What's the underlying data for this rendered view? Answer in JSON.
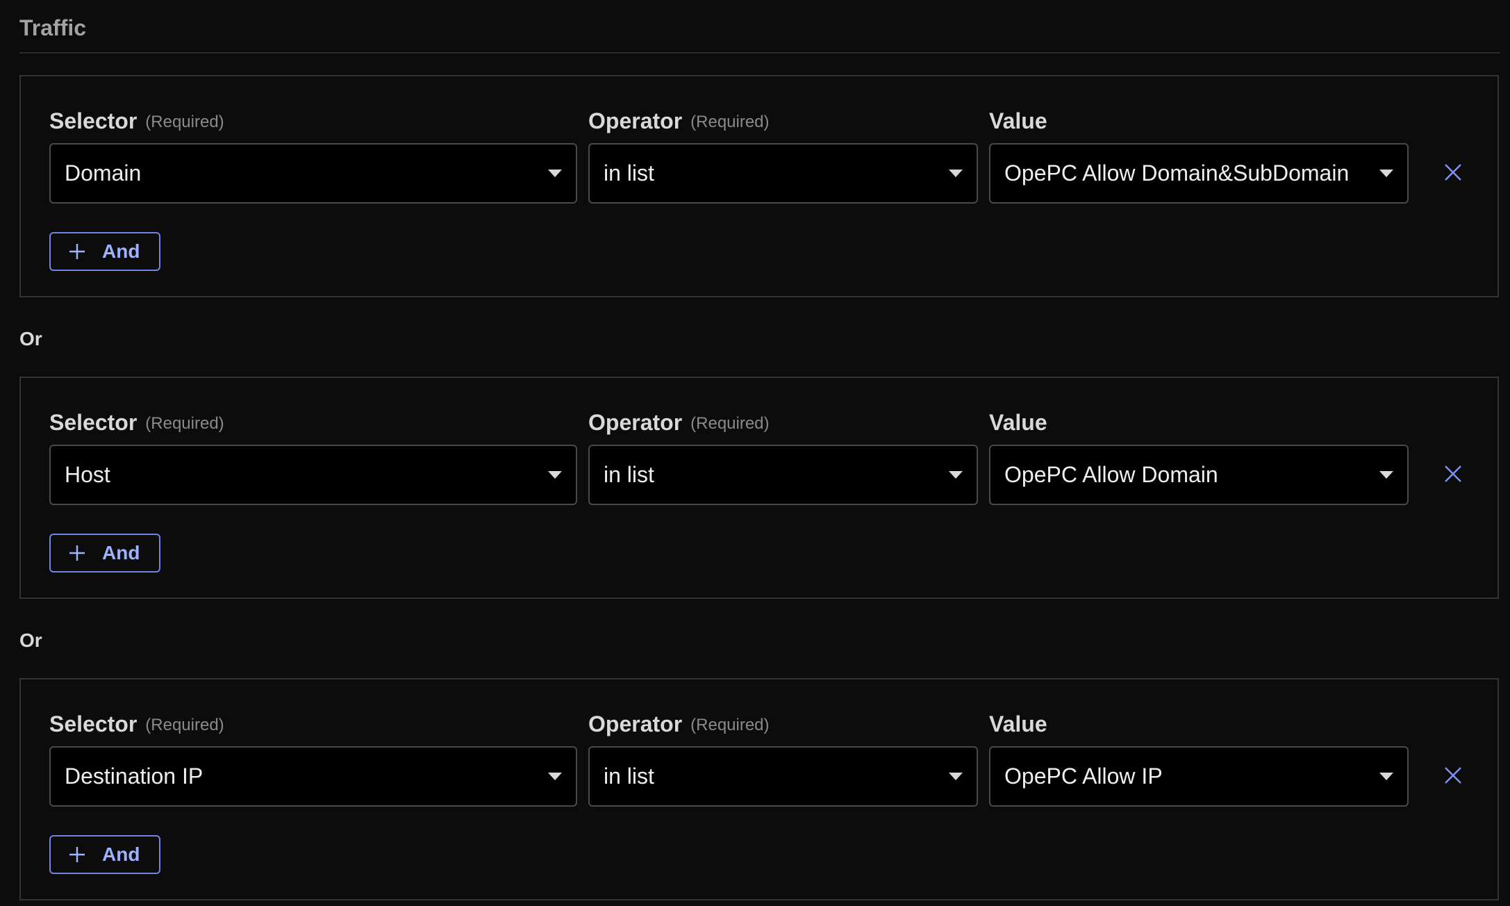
{
  "section": {
    "title": "Traffic"
  },
  "labels": {
    "selector": "Selector",
    "operator": "Operator",
    "value": "Value",
    "required": "(Required)",
    "and_button": "And",
    "or": "Or"
  },
  "rules": [
    {
      "selector": "Domain",
      "operator": "in list",
      "value": "OpePC Allow Domain&SubDomain"
    },
    {
      "selector": "Host",
      "operator": "in list",
      "value": "OpePC Allow Domain"
    },
    {
      "selector": "Destination IP",
      "operator": "in list",
      "value": "OpePC Allow IP"
    }
  ],
  "icons": {
    "remove": "close-icon",
    "add": "plus-icon",
    "dropdown": "caret-down-icon"
  },
  "colors": {
    "background": "#0c0c0c",
    "accent": "#6f86e6",
    "border": "#333333"
  }
}
